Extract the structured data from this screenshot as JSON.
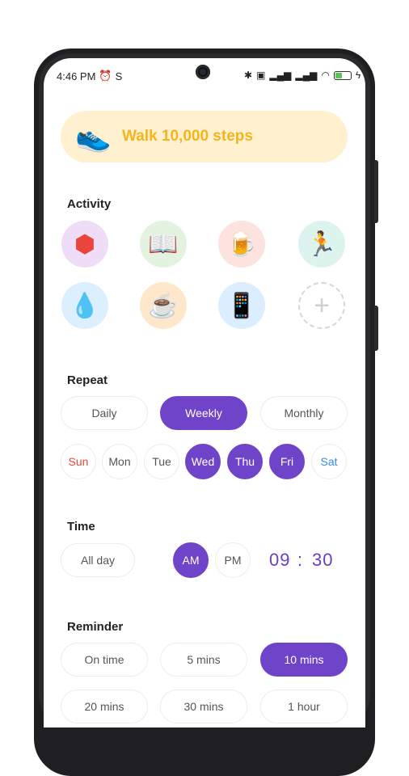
{
  "status_bar": {
    "time": "4:46 PM",
    "alarm_icon": "alarm-icon",
    "extra": "S",
    "icons": [
      "bluetooth-icon",
      "sim-icon",
      "signal-icon",
      "signal-icon",
      "wifi-icon",
      "battery-icon",
      "charging-icon"
    ],
    "battery_level": "45"
  },
  "goal": {
    "title": "Walk 10,000 steps",
    "icon": "sneaker-icon"
  },
  "activity": {
    "title": "Activity",
    "items": [
      {
        "name": "hexagons",
        "glyph": "⬢",
        "bg": "#efdcf6"
      },
      {
        "name": "book",
        "glyph": "📖",
        "bg": "#e3f3df"
      },
      {
        "name": "beer",
        "glyph": "🍺",
        "bg": "#fde3df"
      },
      {
        "name": "runner",
        "glyph": "🏃",
        "bg": "#ddf3ee"
      },
      {
        "name": "water",
        "glyph": "💧",
        "bg": "#dcefff"
      },
      {
        "name": "coffee",
        "glyph": "☕",
        "bg": "#ffe7cc"
      },
      {
        "name": "phone",
        "glyph": "📱",
        "bg": "#dbeeff"
      },
      {
        "name": "add",
        "glyph": "+",
        "bg": "#ffffff"
      }
    ]
  },
  "repeat": {
    "title": "Repeat",
    "options": [
      "Daily",
      "Weekly",
      "Monthly"
    ],
    "selected": "Weekly",
    "days": [
      "Sun",
      "Mon",
      "Tue",
      "Wed",
      "Thu",
      "Fri",
      "Sat"
    ],
    "selected_days": [
      "Wed",
      "Thu",
      "Fri"
    ],
    "sun_color": "#e8453c",
    "sat_color": "#3a8de0"
  },
  "time": {
    "title": "Time",
    "all_day": "All day",
    "am": "AM",
    "pm": "PM",
    "selected": "AM",
    "hour": "09",
    "separator": ":",
    "minute": "30"
  },
  "reminder": {
    "title": "Reminder",
    "options": [
      "On time",
      "5 mins",
      "10 mins",
      "20 mins",
      "30 mins",
      "1 hour"
    ],
    "selected": "10 mins"
  },
  "colors": {
    "accent": "#7044c8",
    "goal_bg": "#fff1cf",
    "goal_text": "#f2b51e"
  }
}
